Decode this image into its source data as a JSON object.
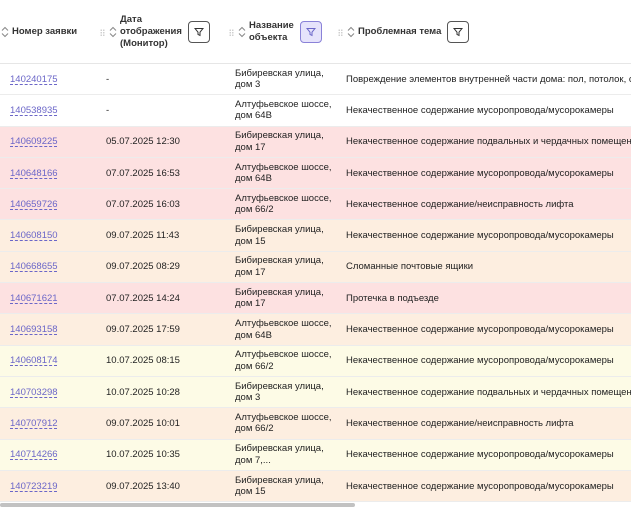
{
  "columns": {
    "c1": "Номер заявки",
    "c2_line1": "Дата",
    "c2_line2": "отображения",
    "c2_line3": "(Монитор)",
    "c3_line1": "Название",
    "c3_line2": "объекта",
    "c4": "Проблемная тема"
  },
  "colors": {
    "red": "#fde1e1",
    "peach": "#fdeee0",
    "yellow": "#fdfbe6",
    "link": "#6b66c8"
  },
  "rows": [
    {
      "id": "140240175",
      "date": "-",
      "object": "Бибиревская улица, дом 3",
      "topic": "Повреждение элементов внутренней части дома: пол, потолок, ст",
      "tone": "white"
    },
    {
      "id": "140538935",
      "date": "-",
      "object": "Алтуфьевское шоссе, дом 64В",
      "topic": "Некачественное содержание мусоропровода/мусорокамеры",
      "tone": "white"
    },
    {
      "id": "140609225",
      "date": "05.07.2025 12:30",
      "object": "Бибиревская улица, дом 17",
      "topic": "Некачественное содержание подвальных и чердачных помещени",
      "tone": "red"
    },
    {
      "id": "140648166",
      "date": "07.07.2025 16:53",
      "object": "Алтуфьевское шоссе, дом 64В",
      "topic": "Некачественное содержание мусоропровода/мусорокамеры",
      "tone": "red"
    },
    {
      "id": "140659726",
      "date": "07.07.2025 16:03",
      "object": "Алтуфьевское шоссе, дом 66/2",
      "topic": "Некачественное содержание/неисправность лифта",
      "tone": "red"
    },
    {
      "id": "140608150",
      "date": "09.07.2025 11:43",
      "object": "Бибиревская улица, дом 15",
      "topic": "Некачественное содержание мусоропровода/мусорокамеры",
      "tone": "peach"
    },
    {
      "id": "140668655",
      "date": "09.07.2025 08:29",
      "object": "Бибиревская улица, дом 17",
      "topic": "Сломанные почтовые ящики",
      "tone": "peach"
    },
    {
      "id": "140671621",
      "date": "07.07.2025 14:24",
      "object": "Бибиревская улица, дом 17",
      "topic": "Протечка в подъезде",
      "tone": "red"
    },
    {
      "id": "140693158",
      "date": "09.07.2025 17:59",
      "object": "Алтуфьевское шоссе, дом 64В",
      "topic": "Некачественное содержание мусоропровода/мусорокамеры",
      "tone": "peach"
    },
    {
      "id": "140608174",
      "date": "10.07.2025 08:15",
      "object": "Алтуфьевское шоссе, дом 66/2",
      "topic": "Некачественное содержание мусоропровода/мусорокамеры",
      "tone": "yellow"
    },
    {
      "id": "140703298",
      "date": "10.07.2025 10:28",
      "object": "Бибиревская улица, дом 3",
      "topic": "Некачественное содержание подвальных и чердачных помещени",
      "tone": "yellow"
    },
    {
      "id": "140707912",
      "date": "09.07.2025 10:01",
      "object": "Алтуфьевское шоссе, дом 66/2",
      "topic": "Некачественное содержание/неисправность лифта",
      "tone": "peach"
    },
    {
      "id": "140714266",
      "date": "10.07.2025 10:35",
      "object": "Бибиревская улица, дом 7,...",
      "topic": "Некачественное содержание мусоропровода/мусорокамеры",
      "tone": "yellow"
    },
    {
      "id": "140723219",
      "date": "09.07.2025 13:40",
      "object": "Бибиревская улица, дом 15",
      "topic": "Некачественное содержание мусоропровода/мусорокамеры",
      "tone": "peach"
    }
  ]
}
